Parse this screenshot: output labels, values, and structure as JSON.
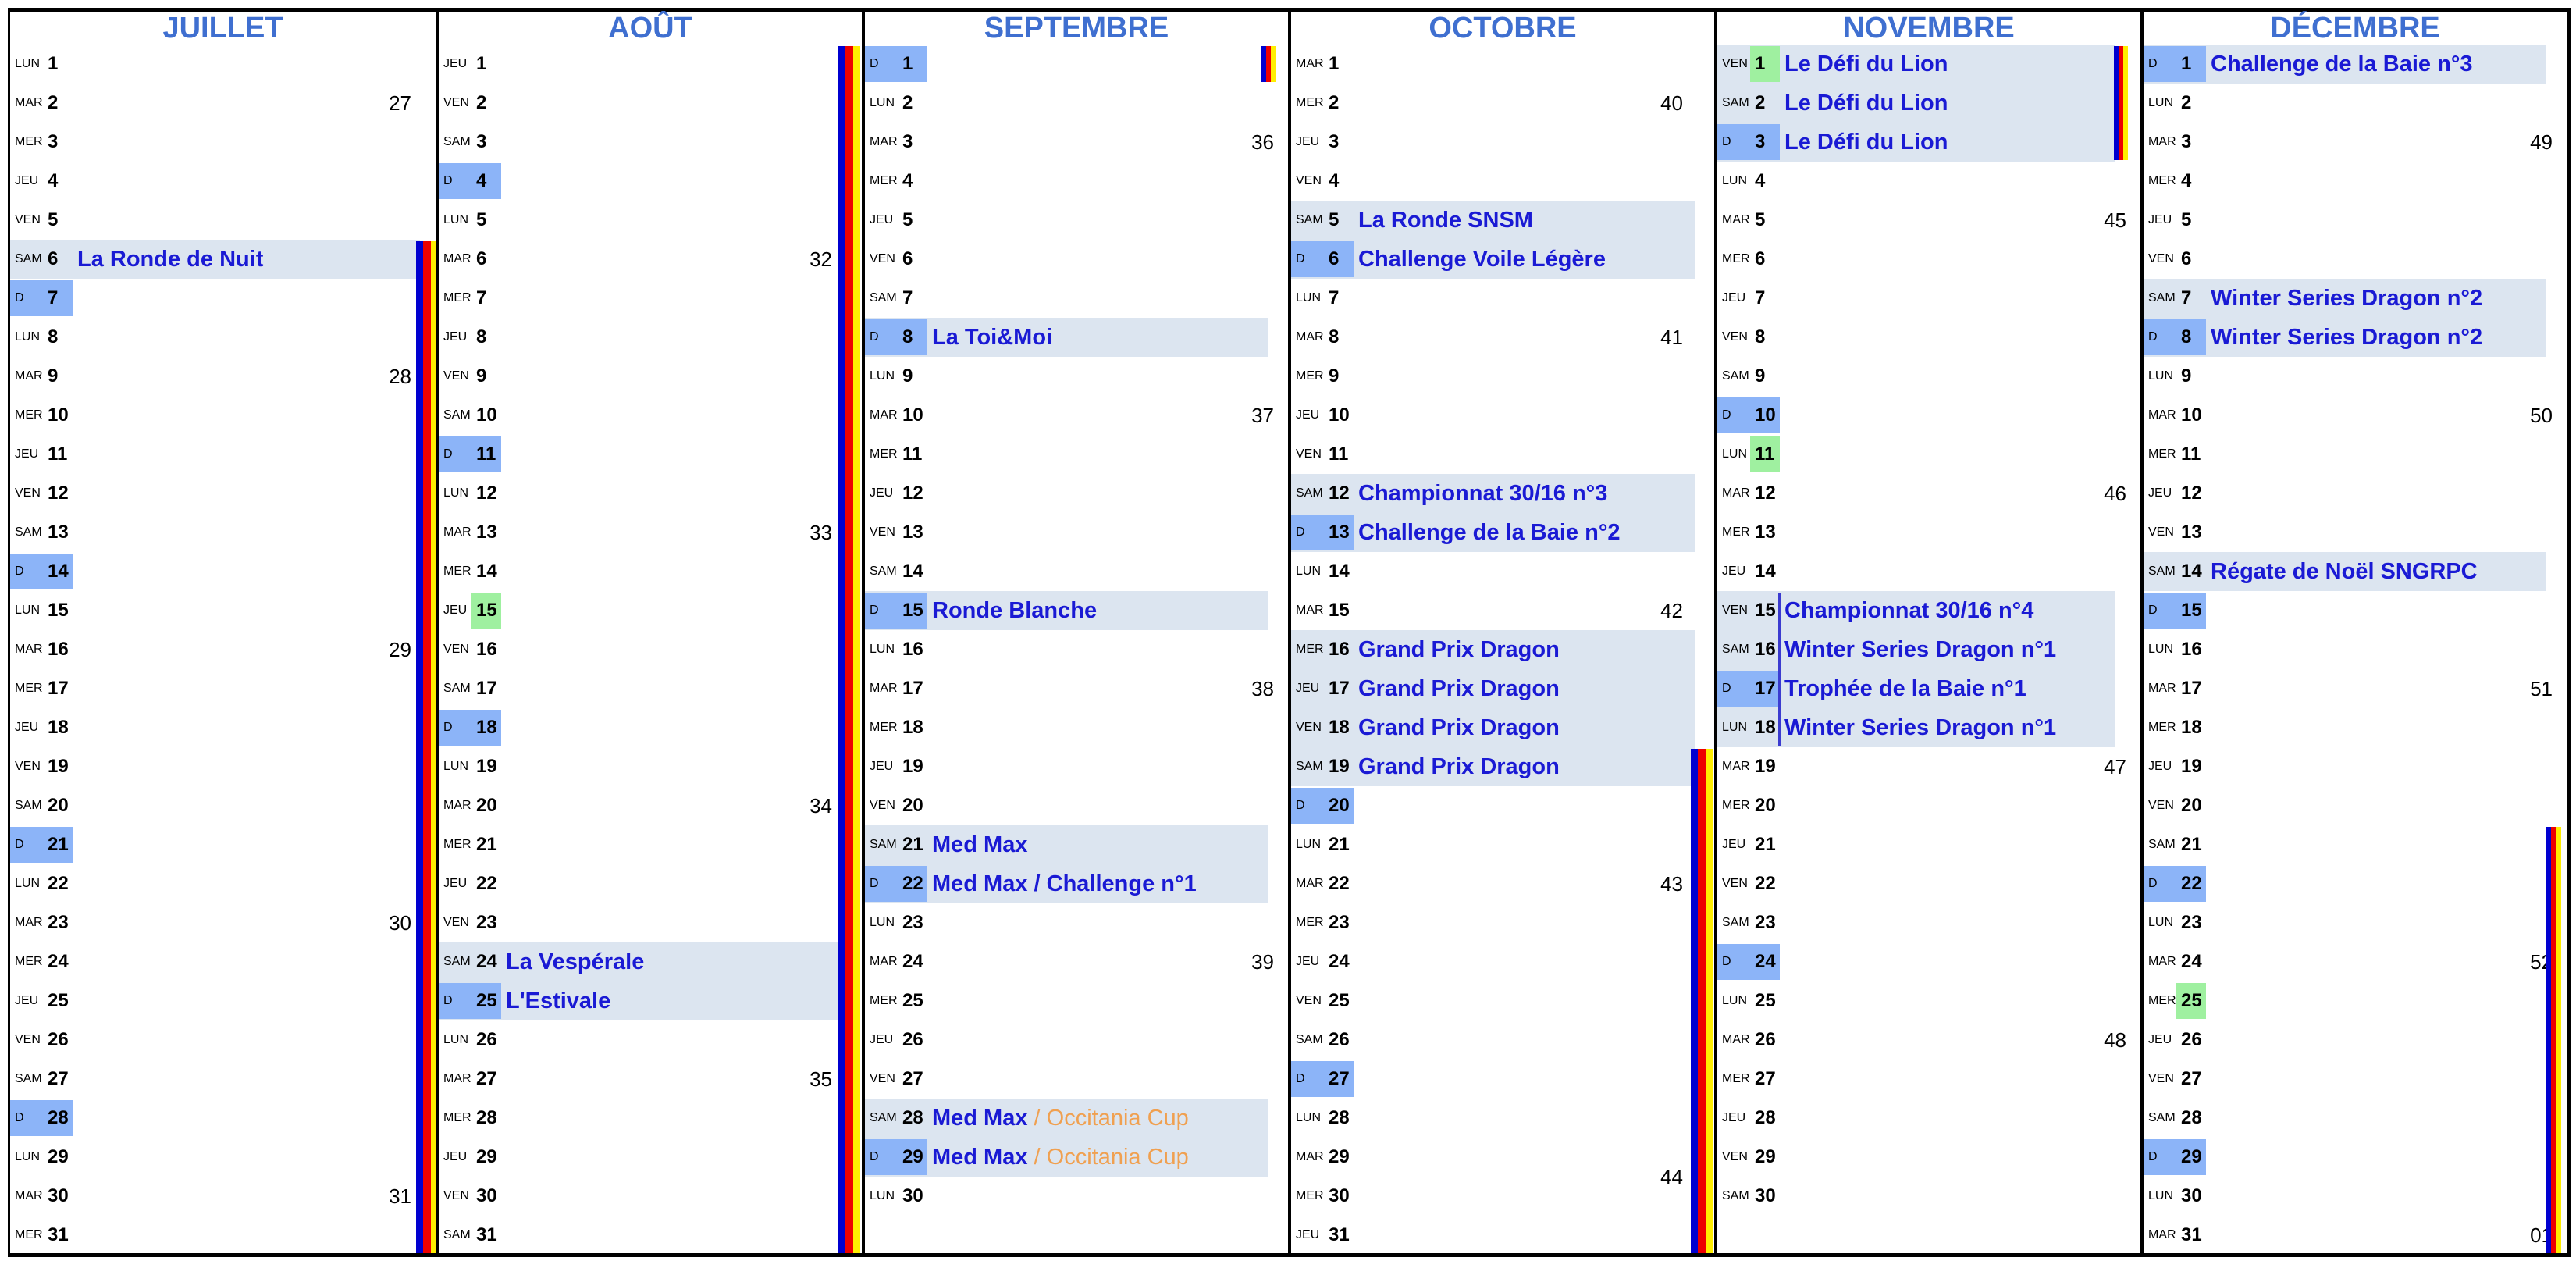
{
  "colors": {
    "title": "#3f6fd0",
    "event": "#1a1ad4",
    "event_extra": "#f0a050",
    "event_bg": "#dce5f0",
    "sunday": "#8cb4f8",
    "holiday": "#9ff0a0",
    "stripe": [
      "#0000d0",
      "#ee0000",
      "#ffee00"
    ]
  },
  "months": [
    {
      "name": "JUILLET",
      "days": [
        "LUN",
        "MAR",
        "MER",
        "JEU",
        "VEN",
        "SAM",
        "D",
        "LUN",
        "MAR",
        "MER",
        "JEU",
        "VEN",
        "SAM",
        "D",
        "LUN",
        "MAR",
        "MER",
        "JEU",
        "VEN",
        "SAM",
        "D",
        "LUN",
        "MAR",
        "MER",
        "JEU",
        "VEN",
        "SAM",
        "D",
        "LUN",
        "MAR",
        "MER"
      ],
      "holidays": [],
      "events": [
        {
          "day": 6,
          "text": "La Ronde de Nuit"
        }
      ],
      "weeks": [
        {
          "day": 2,
          "num": "27"
        },
        {
          "day": 9,
          "num": "28"
        },
        {
          "day": 16,
          "num": "29"
        },
        {
          "day": 23,
          "num": "30"
        },
        {
          "day": 30,
          "num": "31"
        }
      ]
    },
    {
      "name": "AOÛT",
      "days": [
        "JEU",
        "VEN",
        "SAM",
        "D",
        "LUN",
        "MAR",
        "MER",
        "JEU",
        "VEN",
        "SAM",
        "D",
        "LUN",
        "MAR",
        "MER",
        "JEU",
        "VEN",
        "SAM",
        "D",
        "LUN",
        "MAR",
        "MER",
        "JEU",
        "VEN",
        "SAM",
        "D",
        "LUN",
        "MAR",
        "MER",
        "JEU",
        "VEN",
        "SAM"
      ],
      "holidays": [
        15
      ],
      "events": [
        {
          "day": 24,
          "text": "La Vespérale"
        },
        {
          "day": 25,
          "text": "L'Estivale"
        }
      ],
      "weeks": [
        {
          "day": 6,
          "num": "32"
        },
        {
          "day": 13,
          "num": "33"
        },
        {
          "day": 20,
          "num": "34"
        },
        {
          "day": 27,
          "num": "35"
        }
      ]
    },
    {
      "name": "SEPTEMBRE",
      "days": [
        "D",
        "LUN",
        "MAR",
        "MER",
        "JEU",
        "VEN",
        "SAM",
        "D",
        "LUN",
        "MAR",
        "MER",
        "JEU",
        "VEN",
        "SAM",
        "D",
        "LUN",
        "MAR",
        "MER",
        "JEU",
        "VEN",
        "SAM",
        "D",
        "LUN",
        "MAR",
        "MER",
        "JEU",
        "VEN",
        "SAM",
        "D",
        "LUN"
      ],
      "holidays": [],
      "events": [
        {
          "day": 8,
          "text": "La Toi&Moi"
        },
        {
          "day": 15,
          "text": "Ronde Blanche"
        },
        {
          "day": 21,
          "text": "Med Max"
        },
        {
          "day": 22,
          "text": "Med Max / Challenge n°1"
        },
        {
          "day": 28,
          "text": "Med Max",
          "extra": " / Occitania Cup"
        },
        {
          "day": 29,
          "text": "Med Max",
          "extra": " / Occitania Cup"
        }
      ],
      "weeks": [
        {
          "day": 3,
          "num": "36"
        },
        {
          "day": 10,
          "num": "37"
        },
        {
          "day": 17,
          "num": "38"
        },
        {
          "day": 24,
          "num": "39"
        }
      ]
    },
    {
      "name": "OCTOBRE",
      "days": [
        "MAR",
        "MER",
        "JEU",
        "VEN",
        "SAM",
        "D",
        "LUN",
        "MAR",
        "MER",
        "JEU",
        "VEN",
        "SAM",
        "D",
        "LUN",
        "MAR",
        "MER",
        "JEU",
        "VEN",
        "SAM",
        "D",
        "LUN",
        "MAR",
        "MER",
        "JEU",
        "VEN",
        "SAM",
        "D",
        "LUN",
        "MAR",
        "MER",
        "JEU"
      ],
      "holidays": [],
      "events": [
        {
          "day": 5,
          "text": "La Ronde SNSM"
        },
        {
          "day": 6,
          "text": "Challenge Voile Légère"
        },
        {
          "day": 12,
          "text": "Championnat 30/16 n°3"
        },
        {
          "day": 13,
          "text": "Challenge de la Baie n°2"
        },
        {
          "day": 16,
          "text": "Grand Prix Dragon"
        },
        {
          "day": 17,
          "text": "Grand Prix Dragon"
        },
        {
          "day": 18,
          "text": "Grand Prix Dragon"
        },
        {
          "day": 19,
          "text": "Grand Prix Dragon"
        }
      ],
      "weeks": [
        {
          "day": 2,
          "num": "40"
        },
        {
          "day": 8,
          "num": "41"
        },
        {
          "day": 15,
          "num": "42"
        },
        {
          "day": 22,
          "num": "43"
        },
        {
          "day": 29.5,
          "num": "44"
        }
      ]
    },
    {
      "name": "NOVEMBRE",
      "days": [
        "VEN",
        "SAM",
        "D",
        "LUN",
        "MAR",
        "MER",
        "JEU",
        "VEN",
        "SAM",
        "D",
        "LUN",
        "MAR",
        "MER",
        "JEU",
        "VEN",
        "SAM",
        "D",
        "LUN",
        "MAR",
        "MER",
        "JEU",
        "VEN",
        "SAM",
        "D",
        "LUN",
        "MAR",
        "MER",
        "JEU",
        "VEN",
        "SAM"
      ],
      "holidays": [
        1,
        11
      ],
      "events": [
        {
          "day": 1,
          "text": "Le Défi du Lion"
        },
        {
          "day": 2,
          "text": "Le Défi du Lion"
        },
        {
          "day": 3,
          "text": "Le Défi du Lion"
        },
        {
          "day": 15,
          "text": "Championnat 30/16 n°4"
        },
        {
          "day": 16,
          "text": "Winter Series Dragon n°1"
        },
        {
          "day": 17,
          "text": "Trophée de la Baie n°1"
        },
        {
          "day": 18,
          "text": "Winter Series Dragon n°1"
        }
      ],
      "weeks": [
        {
          "day": 5,
          "num": "45"
        },
        {
          "day": 12,
          "num": "46"
        },
        {
          "day": 19,
          "num": "47"
        },
        {
          "day": 26,
          "num": "48"
        }
      ]
    },
    {
      "name": "DÉCEMBRE",
      "days": [
        "D",
        "LUN",
        "MAR",
        "MER",
        "JEU",
        "VEN",
        "SAM",
        "D",
        "LUN",
        "MAR",
        "MER",
        "JEU",
        "VEN",
        "SAM",
        "D",
        "LUN",
        "MAR",
        "MER",
        "JEU",
        "VEN",
        "SAM",
        "D",
        "LUN",
        "MAR",
        "MER",
        "JEU",
        "VEN",
        "SAM",
        "D",
        "LUN",
        "MAR"
      ],
      "holidays": [
        25
      ],
      "events": [
        {
          "day": 1,
          "text": "Challenge de la Baie n°3"
        },
        {
          "day": 7,
          "text": "Winter Series Dragon n°2"
        },
        {
          "day": 8,
          "text": "Winter Series Dragon n°2"
        },
        {
          "day": 14,
          "text": "Régate de Noël SNGRPC"
        }
      ],
      "weeks": [
        {
          "day": 3,
          "num": "49"
        },
        {
          "day": 10,
          "num": "50"
        },
        {
          "day": 17,
          "num": "51"
        },
        {
          "day": 24,
          "num": "52"
        },
        {
          "day": 31,
          "num": "01"
        }
      ]
    }
  ]
}
